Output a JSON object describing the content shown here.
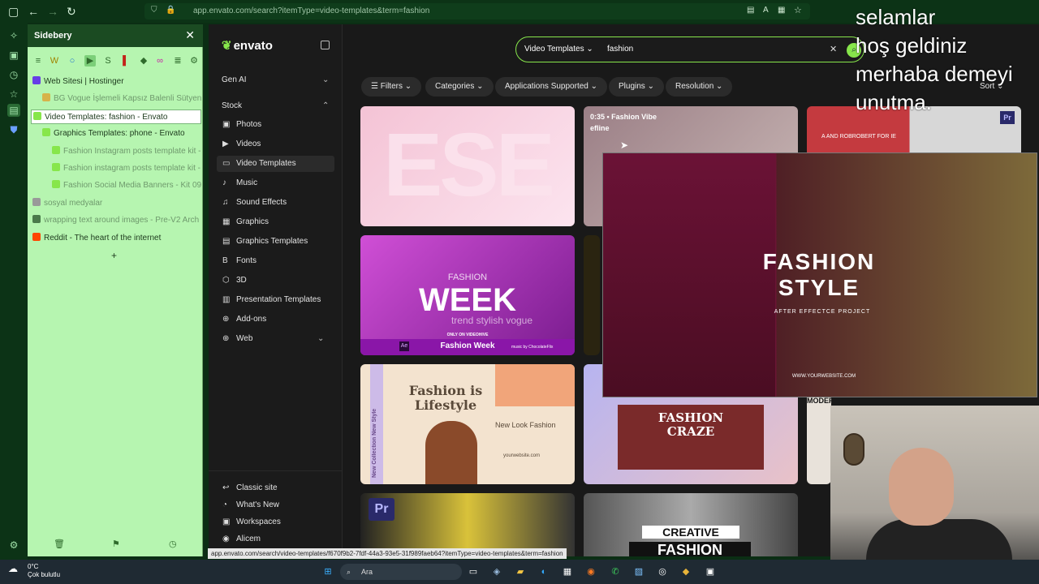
{
  "browser": {
    "url": "app.envato.com/search?itemType=video-templates&term=fashion"
  },
  "overlay_text": [
    "selamlar",
    "hoş geldiniz",
    "merhaba demeyi",
    "unutma."
  ],
  "sidebery": {
    "title": "Sidebery",
    "tabs": [
      {
        "label": "Web Sitesi | Hostinger",
        "color": "#673de6",
        "dim": false,
        "indent": 0
      },
      {
        "label": "BG Vogue İşlemeli Kapsız Balenli Sütyen B",
        "color": "#d6b34a",
        "dim": true,
        "indent": 1
      },
      {
        "label": "Video Templates: fashion - Envato",
        "color": "#87e64b",
        "dim": false,
        "indent": 0,
        "active": true
      },
      {
        "label": "Graphics Templates: phone - Envato",
        "color": "#87e64b",
        "dim": false,
        "indent": 1
      },
      {
        "label": "Fashion Instagram posts template kit - 1",
        "color": "#87e64b",
        "dim": true,
        "indent": 2
      },
      {
        "label": "Fashion instagram posts template kit - 0",
        "color": "#87e64b",
        "dim": true,
        "indent": 2
      },
      {
        "label": "Fashion Social Media Banners - Kit 09 - (",
        "color": "#87e64b",
        "dim": true,
        "indent": 2
      },
      {
        "label": "sosyal medyalar",
        "color": "#999999",
        "dim": true,
        "indent": 0
      },
      {
        "label": "wrapping text around images - Pre-V2 Arch",
        "color": "#4a7a4a",
        "dim": true,
        "indent": 0
      },
      {
        "label": "Reddit - The heart of the internet",
        "color": "#ff4500",
        "dim": false,
        "indent": 0
      }
    ]
  },
  "envato": {
    "logo": "envato",
    "nav": {
      "gen_ai": "Gen AI",
      "stock": "Stock",
      "items": [
        "Photos",
        "Videos",
        "Video Templates",
        "Music",
        "Sound Effects",
        "Graphics",
        "Graphics Templates",
        "Fonts",
        "3D",
        "Presentation Templates",
        "Add-ons",
        "Web"
      ],
      "bottom": [
        "Classic site",
        "What's New",
        "Workspaces",
        "Alicem"
      ]
    },
    "search": {
      "type": "Video Templates",
      "term": "fashion"
    },
    "filters": [
      "Filters",
      "Categories",
      "Applications Supported",
      "Plugins",
      "Resolution"
    ],
    "sort": "Sort",
    "cards": {
      "c2_duration": "0:35 • Fashion Vibe",
      "c2_author": "efline",
      "c3_text": "A AND ROBROBERT FOR IE",
      "week_title": "WEEK",
      "week_top": "FASHION",
      "week_sub": "trend stylish vogue",
      "week_badge": "ONLY ON VIDEOHIVE",
      "week_name": "Fashion Week",
      "week_music": "music by ChocolateFlix",
      "lifestyle_title": "Fashion is Lifestyle",
      "lifestyle_sub": "New Look Fashion",
      "lifestyle_side": "New Collection New Style",
      "lifestyle_url": "yourwebsite.com",
      "craze": "FASHION CRAZE",
      "modern": "MODERN",
      "creative": "CREATIVE",
      "creative2": "FASHION",
      "pr": "Pr",
      "ae": "Ae"
    },
    "preview": {
      "title_line1": "FASHION",
      "title_line2": "STYLE",
      "sub": "AFTER EFFECTCE PROJECT",
      "url": "WWW.YOURWEBSITE.COM"
    }
  },
  "status_url": "app.envato.com/search/video-templates/f670f9b2-7fdf-44a3-93e5-31f989faeb64?itemType=video-templates&term=fashion",
  "taskbar": {
    "temp": "0°C",
    "weather": "Çok bulutlu",
    "search": "Ara"
  }
}
